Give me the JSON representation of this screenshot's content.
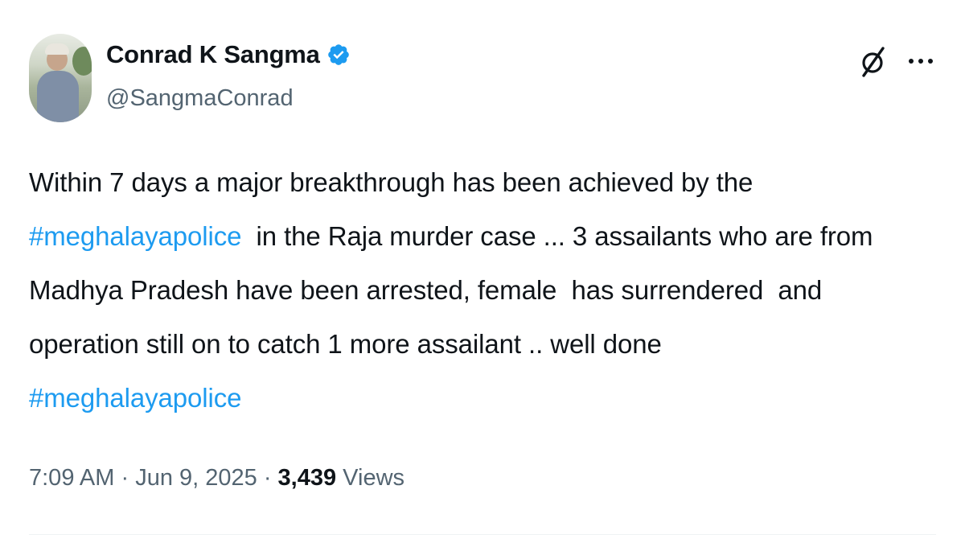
{
  "user": {
    "display_name": "Conrad K Sangma",
    "handle": "@SangmaConrad",
    "verified": true
  },
  "icons": {
    "verified": "verified-badge-icon",
    "grok": "grok-icon",
    "more": "more-options-icon"
  },
  "tweet": {
    "line1": "Within 7 days a major breakthrough has been achieved by the",
    "hashtag1": "#meghalayapolice",
    "line2_rest": "  in the Raja murder case ... 3 assailants who are from",
    "line3": "Madhya Pradesh have been arrested, female  has surrendered  and",
    "line4": "operation still on to catch 1 more assailant .. well done",
    "hashtag2": "#meghalayapolice"
  },
  "meta": {
    "time": "7:09 AM",
    "separator1": " · ",
    "date": "Jun 9, 2025",
    "separator2": " · ",
    "views_count": "3,439",
    "views_label": " Views"
  },
  "colors": {
    "hashtag": "#1d9bf0",
    "secondary_text": "#536471",
    "primary_text": "#0f1419",
    "verified_badge": "#1d9bf0"
  }
}
